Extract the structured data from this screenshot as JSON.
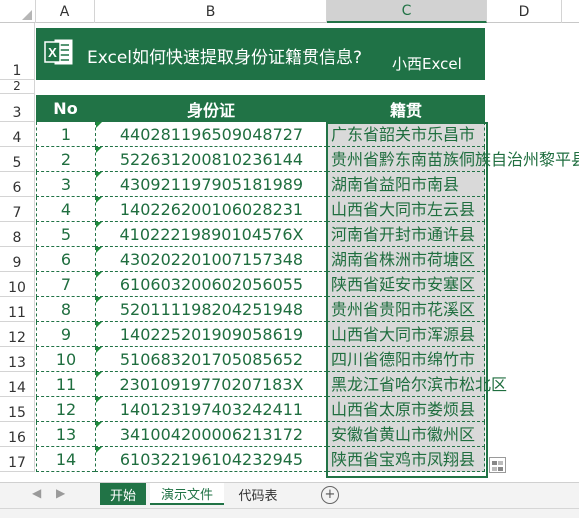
{
  "columns": [
    "A",
    "B",
    "C",
    "D"
  ],
  "row_numbers": [
    "1",
    "2",
    "3",
    "4",
    "5",
    "6",
    "7",
    "8",
    "9",
    "10",
    "11",
    "12",
    "13",
    "14",
    "15",
    "16",
    "17"
  ],
  "banner": {
    "title": "Excel如何快速提取身份证籍贯信息?",
    "brand": "小西Excel",
    "logo_letter": "X"
  },
  "table": {
    "headers": [
      "No",
      "身份证",
      "籍贯"
    ],
    "rows": [
      {
        "no": "1",
        "id": "440281196509048727",
        "addr": "广东省韶关市乐昌市"
      },
      {
        "no": "2",
        "id": "522631200810236144",
        "addr": "贵州省黔东南苗族侗族自治州黎平县"
      },
      {
        "no": "3",
        "id": "430921197905181989",
        "addr": "湖南省益阳市南县"
      },
      {
        "no": "4",
        "id": "140226200106028231",
        "addr": "山西省大同市左云县"
      },
      {
        "no": "5",
        "id": "41022219890104576X",
        "addr": "河南省开封市通许县"
      },
      {
        "no": "6",
        "id": "430202201007157348",
        "addr": "湖南省株洲市荷塘区"
      },
      {
        "no": "7",
        "id": "610603200602056055",
        "addr": "陕西省延安市安塞区"
      },
      {
        "no": "8",
        "id": "520111198204251948",
        "addr": "贵州省贵阳市花溪区"
      },
      {
        "no": "9",
        "id": "140225201909058619",
        "addr": "山西省大同市浑源县"
      },
      {
        "no": "10",
        "id": "510683201705085652",
        "addr": "四川省德阳市绵竹市"
      },
      {
        "no": "11",
        "id": "23010919770207183X",
        "addr": "黑龙江省哈尔滨市松北区"
      },
      {
        "no": "12",
        "id": "140123197403242411",
        "addr": "山西省太原市娄烦县"
      },
      {
        "no": "13",
        "id": "341004200006213172",
        "addr": "安徽省黄山市徽州区"
      },
      {
        "no": "14",
        "id": "610322196104232945",
        "addr": "陕西省宝鸡市凤翔县"
      }
    ]
  },
  "sheet_tabs": [
    "开始",
    "演示文件",
    "代码表"
  ],
  "active_tab": "开始",
  "colors": {
    "accent": "#217346",
    "banner": "#1f7246",
    "selection": "#d9d9d9"
  }
}
